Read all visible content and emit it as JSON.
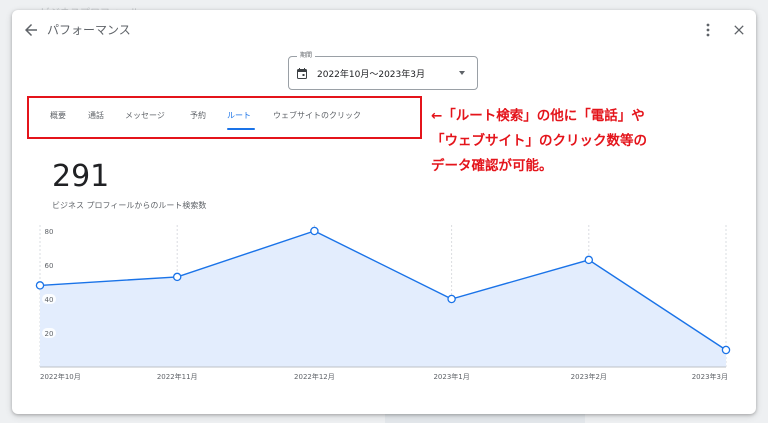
{
  "background": {
    "faded_text": "ビジネスプロフィール"
  },
  "header": {
    "title": "パフォーマンス",
    "back_icon": "arrow-back-icon",
    "more_icon": "more-vert-icon",
    "close_icon": "close-icon"
  },
  "period": {
    "label": "期間",
    "value": "2022年10月〜2023年3月",
    "icon": "calendar-icon"
  },
  "tabs": [
    {
      "label": "概要",
      "active": false
    },
    {
      "label": "通話",
      "active": false
    },
    {
      "label": "メッセージ",
      "active": false
    },
    {
      "label": "予約",
      "active": false
    },
    {
      "label": "ルート",
      "active": true
    },
    {
      "label": "ウェブサイトのクリック",
      "active": false
    }
  ],
  "annotation": {
    "lines": [
      "←「ルート検索」の他に「電話」や",
      "「ウェブサイト」のクリック数等の",
      "データ確認が可能。"
    ],
    "color": "#e4141b"
  },
  "metric": {
    "value": "291",
    "description": "ビジネス プロフィールからのルート検索数"
  },
  "chart_data": {
    "type": "area",
    "categories": [
      "2022年10月",
      "2022年11月",
      "2022年12月",
      "2023年1月",
      "2023年2月",
      "2023年3月"
    ],
    "series": [
      {
        "values": [
          48,
          53,
          80,
          40,
          63,
          10
        ]
      }
    ],
    "y_ticks": [
      "80",
      "60",
      "40",
      "20"
    ],
    "ylim": [
      0,
      80
    ],
    "line_color": "#1a73e8",
    "fill_color": "#e3edfd",
    "grid": "vertical-dashed"
  }
}
